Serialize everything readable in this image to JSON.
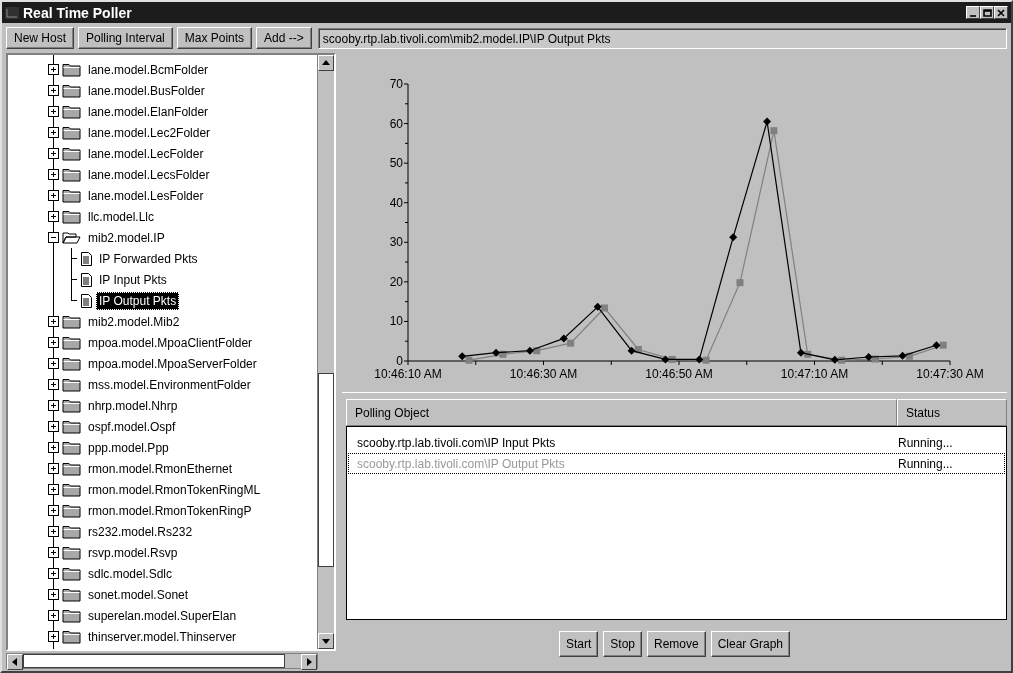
{
  "window": {
    "title": "Real Time Poller"
  },
  "toolbar": {
    "buttons": [
      "New Host",
      "Polling Interval",
      "Max Points",
      "Add -->"
    ],
    "path_field": {
      "value": "scooby.rtp.lab.tivoli.com\\mib2.model.IP\\IP Output Pkts"
    }
  },
  "tree": {
    "items": [
      {
        "label": "lane.model.BcmFolder",
        "expanded": false,
        "selected": false
      },
      {
        "label": "lane.model.BusFolder",
        "expanded": false,
        "selected": false
      },
      {
        "label": "lane.model.ElanFolder",
        "expanded": false,
        "selected": false
      },
      {
        "label": "lane.model.Lec2Folder",
        "expanded": false,
        "selected": false
      },
      {
        "label": "lane.model.LecFolder",
        "expanded": false,
        "selected": false
      },
      {
        "label": "lane.model.LecsFolder",
        "expanded": false,
        "selected": false
      },
      {
        "label": "lane.model.LesFolder",
        "expanded": false,
        "selected": false
      },
      {
        "label": "llc.model.Llc",
        "expanded": false,
        "selected": false
      },
      {
        "label": "mib2.model.IP",
        "expanded": true,
        "selected": false,
        "children": [
          {
            "label": "IP Forwarded Pkts",
            "selected": false
          },
          {
            "label": "IP Input Pkts",
            "selected": false
          },
          {
            "label": "IP Output Pkts",
            "selected": true
          }
        ]
      },
      {
        "label": "mib2.model.Mib2",
        "expanded": false,
        "selected": false
      },
      {
        "label": "mpoa.model.MpoaClientFolder",
        "expanded": false,
        "selected": false
      },
      {
        "label": "mpoa.model.MpoaServerFolder",
        "expanded": false,
        "selected": false
      },
      {
        "label": "mss.model.EnvironmentFolder",
        "expanded": false,
        "selected": false
      },
      {
        "label": "nhrp.model.Nhrp",
        "expanded": false,
        "selected": false
      },
      {
        "label": "ospf.model.Ospf",
        "expanded": false,
        "selected": false
      },
      {
        "label": "ppp.model.Ppp",
        "expanded": false,
        "selected": false
      },
      {
        "label": "rmon.model.RmonEthernet",
        "expanded": false,
        "selected": false
      },
      {
        "label": "rmon.model.RmonTokenRingML",
        "expanded": false,
        "selected": false
      },
      {
        "label": "rmon.model.RmonTokenRingP",
        "expanded": false,
        "selected": false
      },
      {
        "label": "rs232.model.Rs232",
        "expanded": false,
        "selected": false
      },
      {
        "label": "rsvp.model.Rsvp",
        "expanded": false,
        "selected": false
      },
      {
        "label": "sdlc.model.Sdlc",
        "expanded": false,
        "selected": false
      },
      {
        "label": "sonet.model.Sonet",
        "expanded": false,
        "selected": false
      },
      {
        "label": "superelan.model.SuperElan",
        "expanded": false,
        "selected": false
      },
      {
        "label": "thinserver.model.Thinserver",
        "expanded": false,
        "selected": false
      }
    ]
  },
  "chart": {
    "chart_data": {
      "type": "line",
      "ylim": [
        0,
        70
      ],
      "categories": [
        "10:46:10 AM",
        null,
        null,
        null,
        null,
        null,
        null,
        null,
        null,
        null,
        null,
        null,
        null,
        null,
        null,
        null,
        null,
        null,
        null,
        null,
        "10:46:30 AM",
        null,
        null,
        null,
        null,
        null,
        null,
        null,
        null,
        null,
        null,
        null,
        null,
        null,
        null,
        null,
        null,
        null,
        null,
        null,
        "10:46:50 AM",
        null,
        null,
        null,
        null,
        null,
        null,
        null,
        null,
        null,
        null,
        null,
        null,
        null,
        null,
        null,
        null,
        null,
        null,
        null,
        "10:47:10 AM",
        null,
        null,
        null,
        null,
        null,
        null,
        null,
        null,
        null,
        null,
        null,
        null,
        null,
        null,
        null,
        null,
        null,
        null,
        null,
        "10:47:30 AM"
      ],
      "yticks": [
        0,
        10,
        20,
        30,
        40,
        50,
        60,
        70
      ],
      "series": [
        {
          "color": "#000000",
          "marker": "diamond",
          "values": [
            null,
            null,
            null,
            null,
            null,
            null,
            null,
            null,
            1.2,
            null,
            null,
            null,
            null,
            2.1,
            null,
            null,
            null,
            null,
            2.6,
            null,
            null,
            null,
            null,
            5.7,
            null,
            null,
            null,
            null,
            13.7,
            null,
            null,
            null,
            null,
            2.6,
            null,
            null,
            null,
            null,
            0.4,
            null,
            null,
            null,
            null,
            0.4,
            null,
            null,
            null,
            null,
            31.3,
            null,
            null,
            null,
            null,
            60.5,
            null,
            null,
            null,
            null,
            2.1,
            null,
            null,
            null,
            null,
            0.3,
            null,
            null,
            null,
            null,
            1.0,
            null,
            null,
            null,
            null,
            1.3,
            null,
            null,
            null,
            null,
            4.0,
            null,
            null
          ]
        },
        {
          "color": "#808080",
          "marker": "square",
          "values": [
            null,
            null,
            null,
            null,
            null,
            null,
            null,
            null,
            null,
            0.2,
            null,
            null,
            null,
            null,
            1.7,
            null,
            null,
            null,
            null,
            2.6,
            null,
            null,
            null,
            null,
            4.5,
            null,
            null,
            null,
            null,
            13.4,
            null,
            null,
            null,
            null,
            2.9,
            null,
            null,
            null,
            null,
            0.4,
            null,
            null,
            null,
            null,
            0.2,
            null,
            null,
            null,
            null,
            19.8,
            null,
            null,
            null,
            null,
            58.2,
            null,
            null,
            null,
            null,
            1.7,
            null,
            null,
            null,
            null,
            0.2,
            null,
            null,
            null,
            null,
            0.5,
            null,
            null,
            null,
            null,
            1.2,
            null,
            null,
            null,
            null,
            4.0,
            null
          ]
        }
      ]
    }
  },
  "polling_table": {
    "columns": [
      "Polling Object",
      "Status"
    ],
    "rows": [
      {
        "object": "scooby.rtp.lab.tivoli.com\\IP Input Pkts",
        "status": "Running...",
        "color": "#000000",
        "selected": false
      },
      {
        "object": "scooby.rtp.lab.tivoli.com\\IP Output Pkts",
        "status": "Running...",
        "color": "#999999",
        "selected": true
      }
    ]
  },
  "buttons": [
    "Start",
    "Stop",
    "Remove",
    "Clear Graph"
  ]
}
